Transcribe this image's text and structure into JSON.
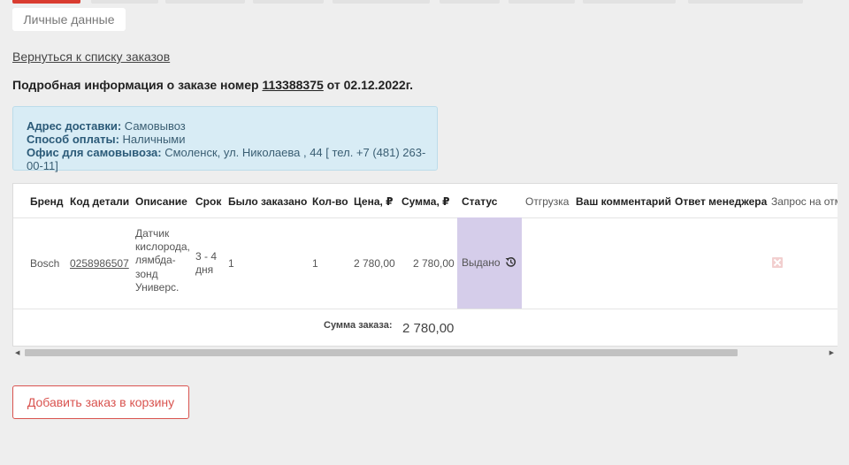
{
  "nav": {
    "personal_tab": "Личные данные"
  },
  "back_link": "Вернуться к списку заказов",
  "order": {
    "heading_prefix": "Подробная информация о заказе номер",
    "number": "113388375",
    "date_text": "от 02.12.2022г."
  },
  "delivery": {
    "address_label": "Адрес доставки:",
    "address_value": "Самовывоз",
    "payment_label": "Способ оплаты:",
    "payment_value": "Наличными",
    "office_label": "Офис для самовывоза:",
    "office_value": "Смоленск, ул. Николаева , 44 [ тел. +7 (481) 263-00-11]"
  },
  "table": {
    "headers": {
      "brand": "Бренд",
      "code": "Код детали",
      "description": "Описание",
      "term": "Срок",
      "ordered": "Было заказано",
      "qty": "Кол-во",
      "price": "Цена, ₽",
      "sum": "Сумма, ₽",
      "status": "Статус",
      "shipment": "Отгрузка",
      "comment": "Ваш комментарий",
      "manager": "Ответ менеджера",
      "request": "Запрос на отм"
    },
    "row": {
      "brand": "Bosch",
      "code": "0258986507",
      "description_lines": [
        "Датчик",
        "кислорода,",
        "лямбда-",
        "зонд",
        "Универс."
      ],
      "term_lines": [
        "3 - 4",
        "дня"
      ],
      "ordered": "1",
      "qty": "1",
      "price": "2 780,00",
      "sum": "2 780,00",
      "status": "Выдано",
      "status_bg": "#d5cdea"
    },
    "total_label": "Сумма заказа:",
    "total_value": "2 780,00"
  },
  "add_to_cart_button": "Добавить заказ в корзину",
  "colors": {
    "accent": "#d9534f",
    "info_bg": "#d8ecf5"
  }
}
